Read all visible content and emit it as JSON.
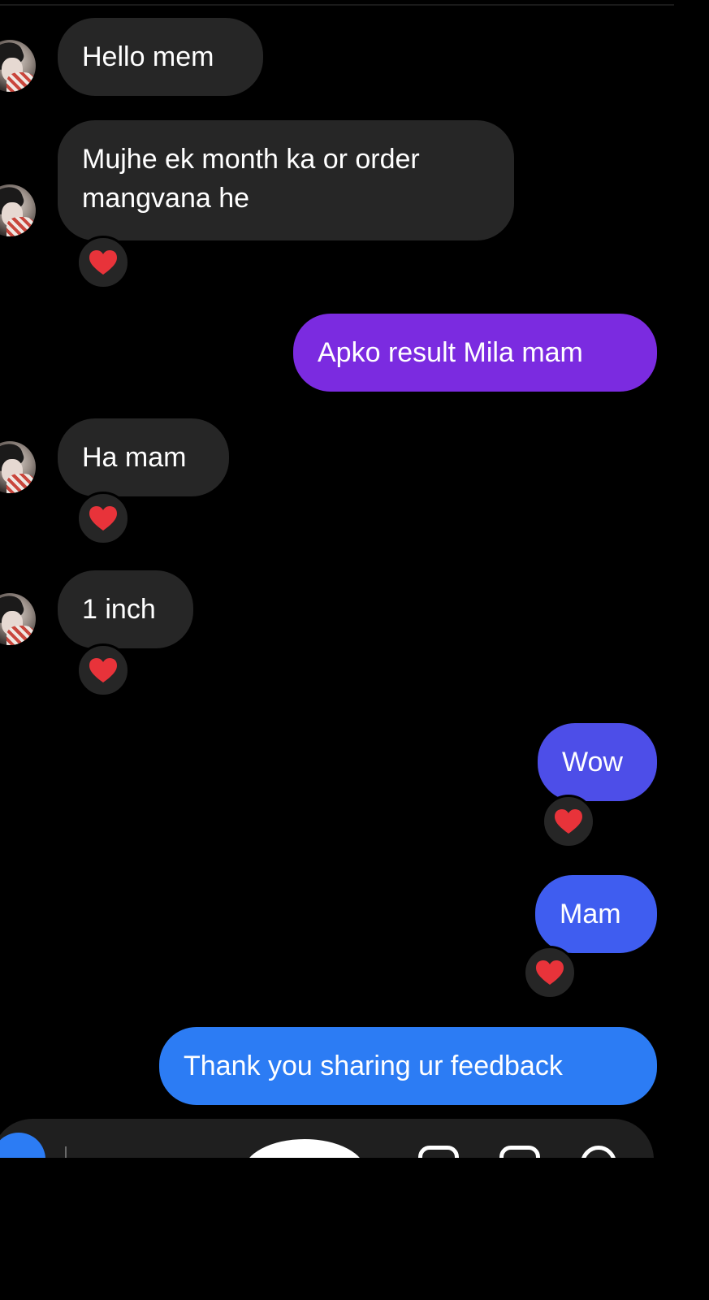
{
  "messages": [
    {
      "id": "m1",
      "text": "Hello mem",
      "direction": "incoming"
    },
    {
      "id": "m2",
      "lines": [
        "Mujhe ek month ka  or order",
        "mangvana he"
      ],
      "direction": "incoming",
      "reaction": "heart"
    },
    {
      "id": "m3",
      "text": "Apko result Mila mam",
      "direction": "outgoing"
    },
    {
      "id": "m4",
      "text": "Ha mam",
      "direction": "incoming",
      "reaction": "heart"
    },
    {
      "id": "m5",
      "text": "1 inch",
      "direction": "incoming",
      "reaction": "heart"
    },
    {
      "id": "m6",
      "text": "Wow",
      "direction": "outgoing",
      "reaction": "heart"
    },
    {
      "id": "m7",
      "text": "Mam",
      "direction": "outgoing",
      "reaction": "heart"
    },
    {
      "id": "m8",
      "text": "Thank you  sharing ur feedback",
      "direction": "outgoing"
    }
  ],
  "reaction_emoji": "❤️",
  "colors": {
    "background": "#000000",
    "incoming_bubble": "#262626",
    "outgoing_purple": "#7b2be0",
    "outgoing_indigo": "#4d4ee8",
    "outgoing_blue": "#2c7cf4",
    "heart": "#e8333a"
  },
  "icons": {
    "avatar": "contact-avatar",
    "reaction": "heart-icon",
    "camera": "camera-icon",
    "composer_field": "message-input",
    "image_tool": "gallery-icon",
    "sticker_tool": "sticker-icon"
  }
}
